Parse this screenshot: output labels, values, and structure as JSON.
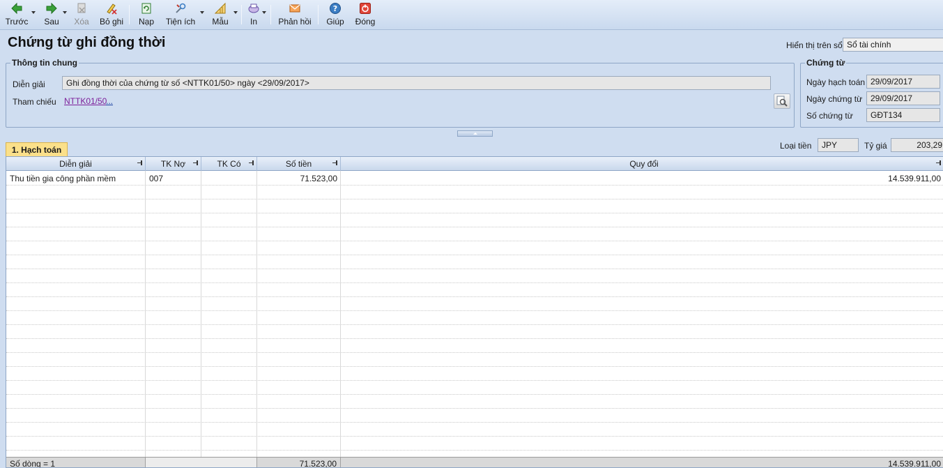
{
  "toolbar": {
    "items": [
      {
        "label": "Trước",
        "icon": "arrow-left-icon"
      },
      {
        "label": "Sau",
        "icon": "arrow-right-icon"
      },
      {
        "label": "Xóa",
        "icon": "delete-icon"
      },
      {
        "label": "Bỏ ghi",
        "icon": "unpost-icon"
      },
      {
        "label": "Nạp",
        "icon": "refresh-icon"
      },
      {
        "label": "Tiện ích",
        "icon": "utilities-icon"
      },
      {
        "label": "Mẫu",
        "icon": "template-icon"
      },
      {
        "label": "In",
        "icon": "print-icon"
      },
      {
        "label": "Phản hồi",
        "icon": "feedback-icon"
      },
      {
        "label": "Giúp",
        "icon": "help-icon"
      },
      {
        "label": "Đóng",
        "icon": "close-icon"
      }
    ]
  },
  "page": {
    "title": "Chứng từ ghi đồng thời",
    "display_label": "Hiển thị trên sổ",
    "display_value": "Sổ tài chính"
  },
  "general": {
    "legend": "Thông tin chung",
    "description_label": "Diễn giải",
    "description_value": "Ghi đồng thời của chứng từ số <NTTK01/50> ngày <29/09/2017>",
    "reference_label": "Tham chiếu",
    "reference_link": "NTTK01/50",
    "reference_more": "..."
  },
  "voucher": {
    "legend": "Chứng từ",
    "posting_date_label": "Ngày hạch toán",
    "posting_date": "29/09/2017",
    "voucher_date_label": "Ngày chứng từ",
    "voucher_date": "29/09/2017",
    "voucher_no_label": "Số chứng từ",
    "voucher_no": "GĐT134"
  },
  "tab": {
    "label": "1. Hạch toán"
  },
  "currency": {
    "label": "Loại tiền",
    "value": "JPY",
    "rate_label": "Tỷ giá",
    "rate_value": "203,29"
  },
  "grid": {
    "columns": [
      "Diễn giải",
      "TK Nợ",
      "TK Có",
      "Số tiền",
      "Quy đổi"
    ],
    "rows": [
      {
        "dien_giai": "Thu tiền gia công phần mềm",
        "tk_no": "007",
        "tk_co": "",
        "so_tien": "71.523,00",
        "quy_doi": "14.539.911,00"
      }
    ],
    "footer": {
      "row_count": "Số dòng = 1",
      "total_so_tien": "71.523,00",
      "total_quy_doi": "14.539.911,00"
    }
  }
}
